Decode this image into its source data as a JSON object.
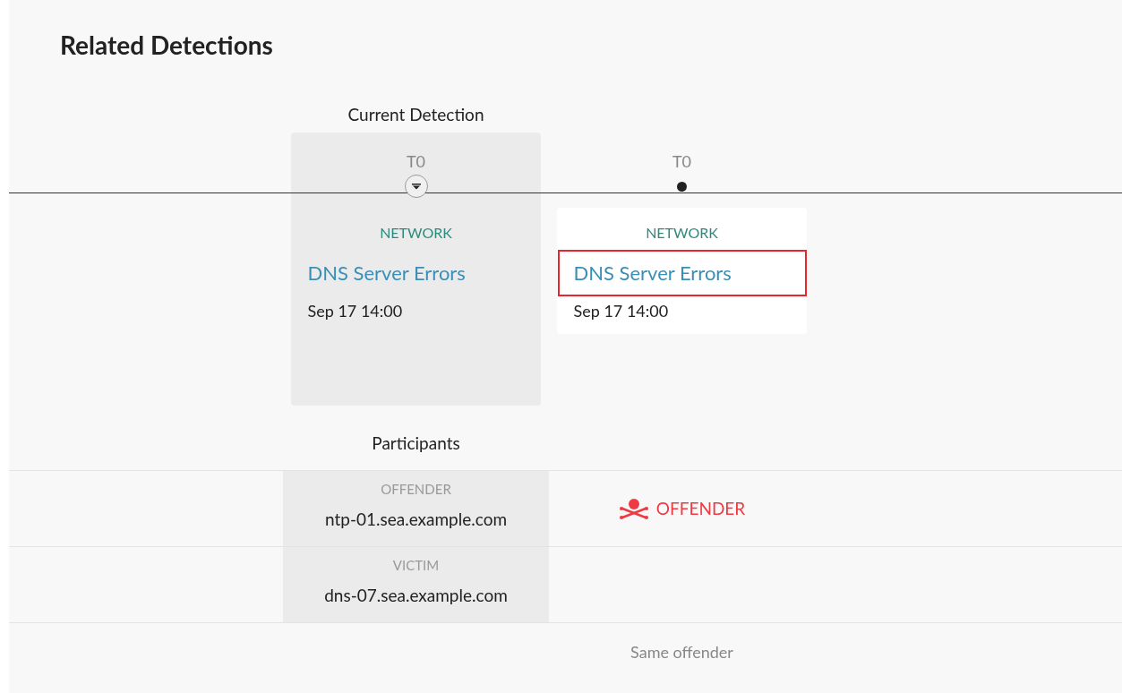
{
  "title": "Related Detections",
  "current_label": "Current Detection",
  "detections": [
    {
      "time": "T0",
      "current": true,
      "category": "NETWORK",
      "title": "DNS Server Errors",
      "date": "Sep 17 14:00",
      "highlighted": false
    },
    {
      "time": "T0",
      "current": false,
      "category": "NETWORK",
      "title": "DNS Server Errors",
      "date": "Sep 17 14:00",
      "highlighted": true
    }
  ],
  "participants_label": "Participants",
  "participants": [
    {
      "role": "OFFENDER",
      "host": "ntp-01.sea.example.com",
      "badges": [
        {
          "kind": "offender",
          "label": "OFFENDER"
        }
      ]
    },
    {
      "role": "VICTIM",
      "host": "dns-07.sea.example.com"
    }
  ],
  "footer": [
    "Same offender"
  ]
}
